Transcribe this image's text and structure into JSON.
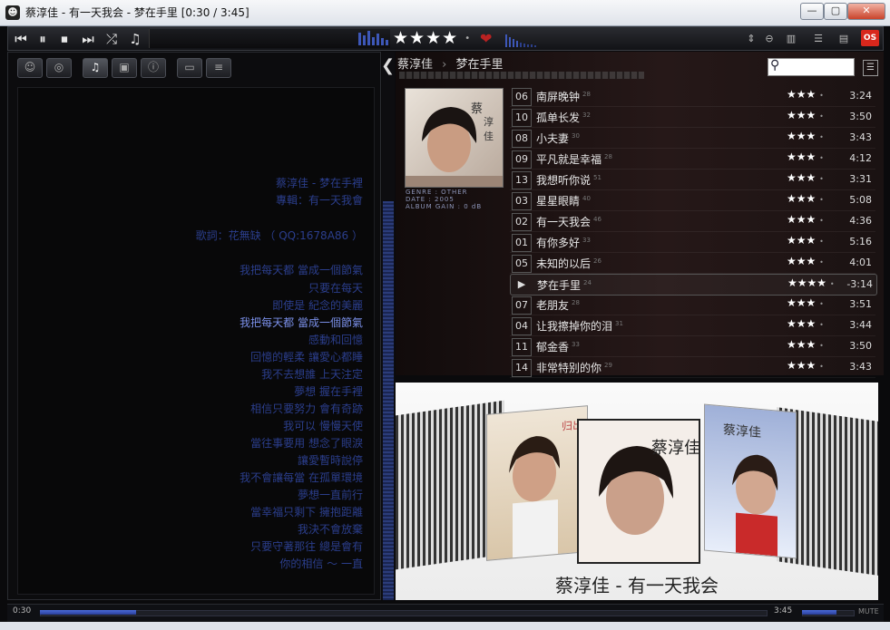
{
  "window": {
    "title": "蔡淳佳 - 有一天我会 - 梦在手里  [0:30 / 3:45]",
    "minimize_glyph": "—",
    "maximize_glyph": "▢",
    "close_glyph": "✕"
  },
  "toolbar": {
    "rating_stars": "★★★★",
    "rating_dot": "•",
    "os_badge": "OS"
  },
  "breadcrumb": {
    "artist": "蔡淳佳",
    "separator": "›",
    "album": "梦在手里"
  },
  "album_meta": {
    "genre": "GENRE : OTHER",
    "date": "DATE : 2005",
    "album_gain": "ALBUM GAIN : 0 dB"
  },
  "tracks": [
    {
      "num": "06",
      "title": "南屏晚钟",
      "count": "28",
      "stars": "★★★",
      "dot": "•",
      "duration": "3:24"
    },
    {
      "num": "10",
      "title": "孤单长发",
      "count": "32",
      "stars": "★★★",
      "dot": "•",
      "duration": "3:50"
    },
    {
      "num": "08",
      "title": "小夫妻",
      "count": "30",
      "stars": "★★★",
      "dot": "•",
      "duration": "3:43"
    },
    {
      "num": "09",
      "title": "平凡就是幸福",
      "count": "28",
      "stars": "★★★",
      "dot": "•",
      "duration": "4:12"
    },
    {
      "num": "13",
      "title": "我想听你说",
      "count": "51",
      "stars": "★★★",
      "dot": "•",
      "duration": "3:31"
    },
    {
      "num": "03",
      "title": "星星眼睛",
      "count": "40",
      "stars": "★★★",
      "dot": "•",
      "duration": "5:08"
    },
    {
      "num": "02",
      "title": "有一天我会",
      "count": "46",
      "stars": "★★★",
      "dot": "•",
      "duration": "4:36"
    },
    {
      "num": "01",
      "title": "有你多好",
      "count": "33",
      "stars": "★★★",
      "dot": "•",
      "duration": "5:16"
    },
    {
      "num": "05",
      "title": "未知的以后",
      "count": "26",
      "stars": "★★★",
      "dot": "•",
      "duration": "4:01"
    },
    {
      "num": "▶",
      "title": "梦在手里",
      "count": "24",
      "stars": "★★★★",
      "dot": "•",
      "duration": "-3:14"
    },
    {
      "num": "07",
      "title": "老朋友",
      "count": "28",
      "stars": "★★★",
      "dot": "•",
      "duration": "3:51"
    },
    {
      "num": "04",
      "title": "让我擦掉你的泪",
      "count": "31",
      "stars": "★★★",
      "dot": "•",
      "duration": "3:44"
    },
    {
      "num": "11",
      "title": "郁金香",
      "count": "33",
      "stars": "★★★",
      "dot": "•",
      "duration": "3:50"
    },
    {
      "num": "14",
      "title": "非常特别的你",
      "count": "29",
      "stars": "★★★",
      "dot": "•",
      "duration": "3:43"
    }
  ],
  "lyrics": [
    "蔡淳佳 - 梦在手裡",
    "專輯：有一天我會",
    "",
    "歌詞：花無缺 （ QQ:1678A86 ）",
    "",
    "我把每天都 當成一個節氣",
    "只要在每天",
    "即使是 紀念的美麗",
    "我把每天都 當成一個節氣",
    "感動和回憶",
    "回憶的輕柔 讓愛心都睡",
    "我不去想誰 上天注定",
    "夢想 握在手裡",
    "相信只要努力 會有奇跡",
    "我可以 慢慢天使",
    "當往事要用 想念了眼淚",
    "讓愛暫時說停",
    "我不會讓每當 在孤單環境",
    "夢想一直前行",
    "當幸福只剩下 擁抱距離",
    "我決不會放棄",
    "只要守著那往 總是會有",
    "你的相信 ～ 一直"
  ],
  "coverflow": {
    "caption": "蔡淳佳 - 有一天我会",
    "left_cover_text": "归出",
    "center_cover_text": "蔡淳佳",
    "right_cover_text": "蔡淳佳"
  },
  "seek": {
    "position": "0:30",
    "duration": "3:45",
    "progress": 0.133,
    "volume": 0.68,
    "mute_label": "MUTE"
  }
}
